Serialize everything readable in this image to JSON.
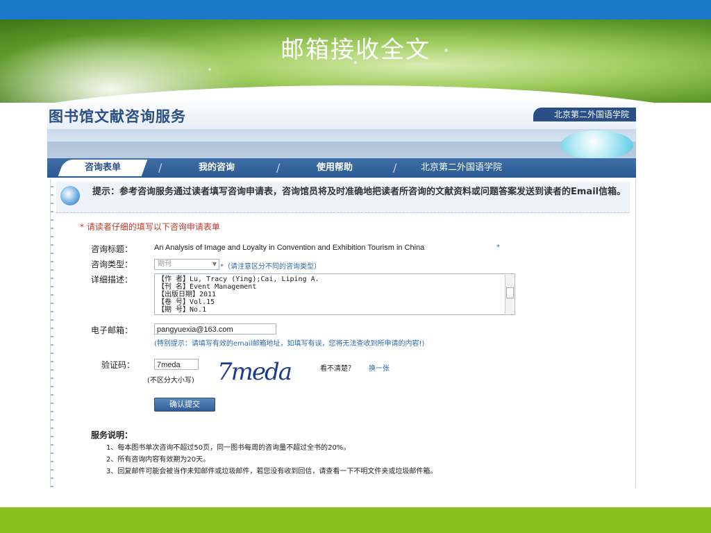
{
  "slide": {
    "title": "邮箱接收全文"
  },
  "colors": {
    "top_bar": "#1a78c8",
    "bottom_bar": "#86c21b",
    "nav": "#2a5a93",
    "accent_red": "#c0392b",
    "link_blue": "#2a6ab0"
  },
  "header": {
    "title": "图书馆文献咨询服务",
    "school": "北京第二外国语学院"
  },
  "nav": {
    "active_tab": "咨询表单",
    "items": [
      "我的咨询",
      "使用帮助",
      "北京第二外国语学院"
    ]
  },
  "tip": {
    "icon": "info-disk-icon",
    "text": "提示：参考咨询服务通过读者填写咨询申请表，咨询馆员将及时准确地把读者所咨询的文献资料或问题答案发送到读者的Email信箱。"
  },
  "form": {
    "required_note": "* 请读者仔细的填写以下咨询申请表单",
    "title_label": "咨询标题：",
    "title_value": "An Analysis of Image and Loyalty in Convention and Exhibition Tourism in China",
    "required_star": "*",
    "type_label": "咨询类型：",
    "type_value": "期刊",
    "type_hint": "*（请注意区分不同的咨询类型）",
    "desc_label": "详细描述：",
    "desc_lines": [
      "【作 者】Lu, Tracy (Ying);Cai, Liping A.",
      "【刊 名】Event Management",
      "【出版日期】2011",
      "【卷 号】Vol.15",
      "【期 号】No.1"
    ],
    "email_label": "电子邮箱：",
    "email_value": "pangyuexia@163.com",
    "email_hint": "(特别提示：请填写有效的email邮箱地址，如填写有误，您将无法查收到所申请的内容!)",
    "captcha_label": "验证码：",
    "captcha_value": "7meda",
    "captcha_case_note": "(不区分大小写)",
    "captcha_image_text": "7meda",
    "captcha_unclear": "看不清楚？",
    "captcha_refresh": "换一张",
    "submit": "确认提交"
  },
  "service": {
    "title": "服务说明：",
    "items": [
      "1、每本图书单次咨询不超过50页，同一图书每周的咨询量不超过全书的20%。",
      "2、所有咨询内容有效期为20天。",
      "3、回复邮件可能会被当作未知邮件或垃圾邮件，若您没有收到回信，请查看一下不明文件夹或垃圾邮件箱。"
    ]
  }
}
